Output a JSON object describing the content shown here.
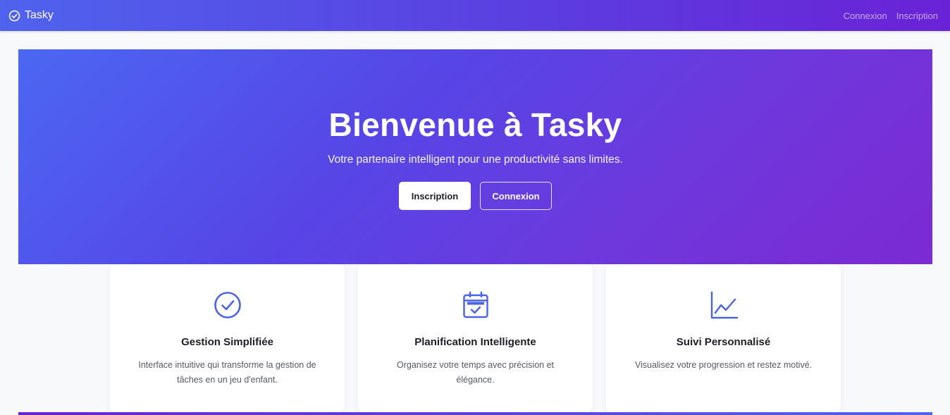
{
  "nav": {
    "brand": "Tasky",
    "links": [
      "Connexion",
      "Inscription"
    ]
  },
  "hero": {
    "title": "Bienvenue à Tasky",
    "subtitle": "Votre partenaire intelligent pour une productivité sans limites.",
    "primary_button": "Inscription",
    "secondary_button": "Connexion"
  },
  "features": [
    {
      "icon": "check-circle-icon",
      "title": "Gestion Simplifiée",
      "text": "Interface intuitive qui transforme la gestion de tâches en un jeu d'enfant."
    },
    {
      "icon": "calendar-check-icon",
      "title": "Planification Intelligente",
      "text": "Organisez votre temps avec précision et élégance."
    },
    {
      "icon": "line-chart-icon",
      "title": "Suivi Personnalisé",
      "text": "Visualisez votre progression et restez motivé."
    }
  ],
  "colors": {
    "accent": "#4f63ee",
    "accent_dark": "#6a22d6",
    "icon": "#4a63e6"
  }
}
